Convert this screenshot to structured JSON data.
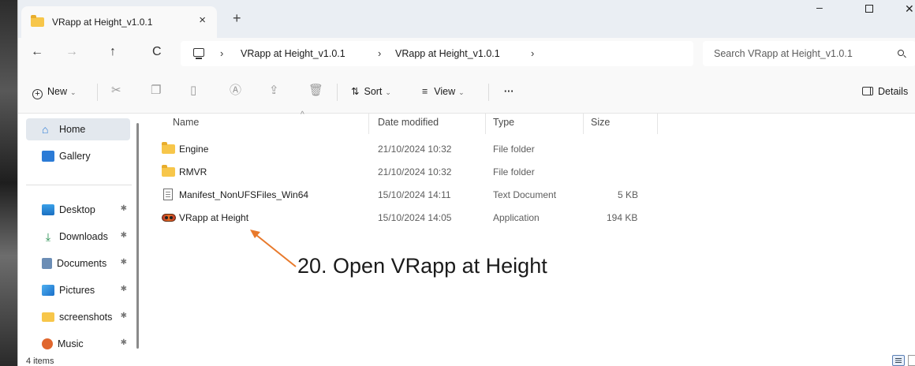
{
  "window": {
    "tab_title": "VRapp at Height_v1.0.1",
    "tab_close": "×",
    "new_tab": "+",
    "minimize": "–",
    "close": "✕"
  },
  "nav": {
    "back": "←",
    "forward": "→",
    "up": "↑",
    "refresh": "C",
    "sep": "›",
    "breadcrumbs": [
      "VRapp at Height_v1.0.1",
      "VRapp at Height_v1.0.1"
    ],
    "search_placeholder": "Search VRapp at Height_v1.0.1"
  },
  "toolbar": {
    "new_label": "New",
    "sort_label": "Sort",
    "view_label": "View",
    "more_label": "···",
    "details_label": "Details"
  },
  "sidebar": {
    "items": [
      {
        "label": "Home",
        "icon": "home-icon"
      },
      {
        "label": "Gallery",
        "icon": "gallery-icon"
      },
      {
        "label": "Desktop",
        "icon": "desktop-icon"
      },
      {
        "label": "Downloads",
        "icon": "downloads-icon"
      },
      {
        "label": "Documents",
        "icon": "documents-icon"
      },
      {
        "label": "Pictures",
        "icon": "pictures-icon"
      },
      {
        "label": "screenshots",
        "icon": "folder-icon"
      },
      {
        "label": "Music",
        "icon": "music-icon"
      }
    ]
  },
  "files": {
    "columns": [
      "Name",
      "Date modified",
      "Type",
      "Size"
    ],
    "rows": [
      {
        "name": "Engine",
        "date": "21/10/2024 10:32",
        "type": "File folder",
        "size": "",
        "icon": "folder-icon"
      },
      {
        "name": "RMVR",
        "date": "21/10/2024 10:32",
        "type": "File folder",
        "size": "",
        "icon": "folder-icon"
      },
      {
        "name": "Manifest_NonUFSFiles_Win64",
        "date": "15/10/2024 14:11",
        "type": "Text Document",
        "size": "5 KB",
        "icon": "text-file-icon"
      },
      {
        "name": "VRapp at Height",
        "date": "15/10/2024 14:05",
        "type": "Application",
        "size": "194 KB",
        "icon": "application-icon"
      }
    ]
  },
  "annotation": {
    "text": "20. Open VRapp at Height",
    "color": "#e8792b"
  },
  "status": {
    "item_count": "4 items"
  }
}
